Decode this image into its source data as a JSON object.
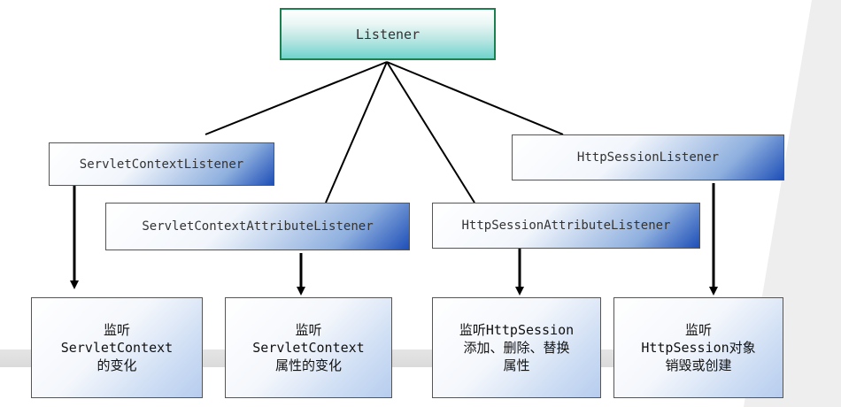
{
  "root": {
    "label": "Listener"
  },
  "interfaces": {
    "servlet_context_listener": "ServletContextListener",
    "servlet_context_attribute_listener": "ServletContextAttributeListener",
    "http_session_attribute_listener": "HttpSessionAttributeListener",
    "http_session_listener": "HttpSessionListener"
  },
  "descriptions": {
    "servlet_context_change": {
      "line1": "监听",
      "line2": "ServletContext",
      "line3": "的变化"
    },
    "servlet_context_attribute_change": {
      "line1": "监听",
      "line2": "ServletContext",
      "line3": "属性的变化"
    },
    "http_session_attribute_change": {
      "line1": "监听HttpSession",
      "line2": "添加、删除、替换",
      "line3": "属性"
    },
    "http_session_lifecycle": {
      "line1": "监听",
      "line2": "HttpSession对象",
      "line3": "销毁或创建"
    }
  },
  "colors": {
    "root_border": "#1b7f4f",
    "root_fill": "#6fd3cd",
    "interface_fill": "#1e4fb8",
    "description_fill": "#b7cdef",
    "connector": "#000000"
  }
}
